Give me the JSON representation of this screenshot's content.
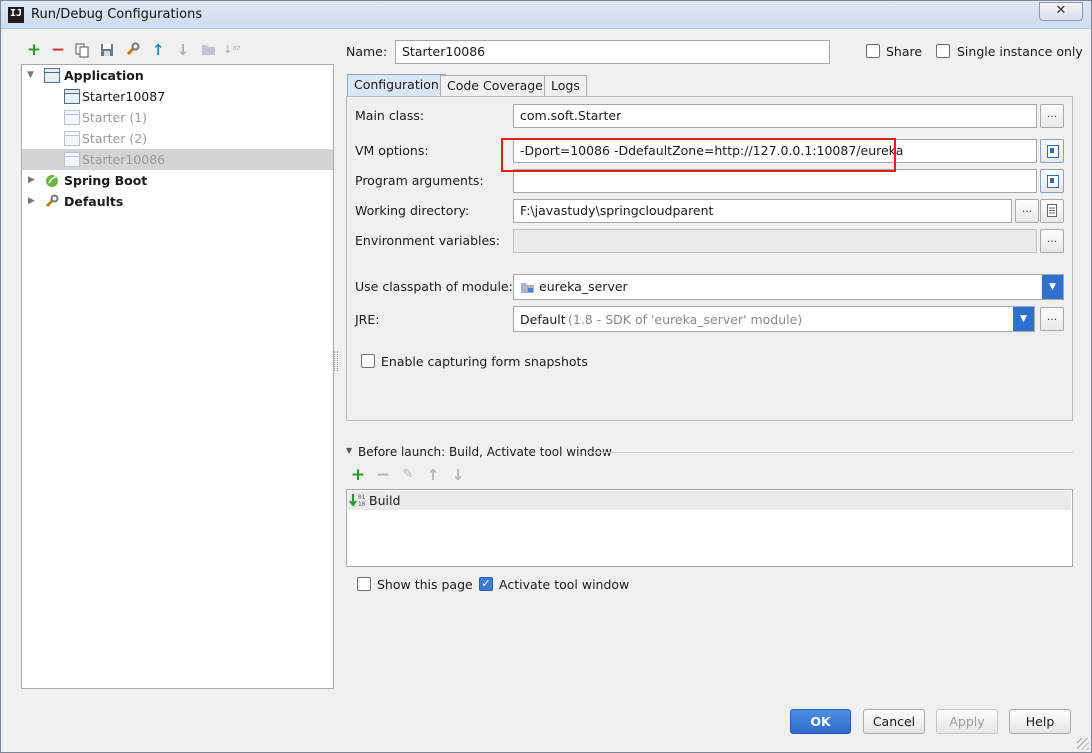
{
  "window": {
    "title": "Run/Debug Configurations",
    "close_glyph": "✕",
    "logo_text": "IJ"
  },
  "toolbar": {
    "icons": [
      "plus-icon",
      "minus-icon",
      "copy-icon",
      "save-icon",
      "wrench-icon",
      "arrow-up-icon",
      "arrow-down-icon",
      "folder-icon",
      "sort-icon"
    ]
  },
  "tree": {
    "items": [
      {
        "label": "Application",
        "icon": "application-icon",
        "expanded": true
      },
      {
        "label": "Starter10087",
        "icon": "config-icon"
      },
      {
        "label": "Starter (1)",
        "icon": "config-icon",
        "dimmed": true
      },
      {
        "label": "Starter (2)",
        "icon": "config-icon",
        "dimmed": true
      },
      {
        "label": "Starter10086",
        "icon": "config-icon",
        "dimmed": true,
        "selected": true
      },
      {
        "label": "Spring Boot",
        "icon": "spring-boot-icon",
        "expanded": false
      },
      {
        "label": "Defaults",
        "icon": "wrench-icon",
        "expanded": false
      }
    ]
  },
  "header": {
    "name_label": "Name:",
    "name_value": "Starter10086",
    "share_label": "Share",
    "share_checked": false,
    "single_instance_label": "Single instance only",
    "single_instance_checked": false
  },
  "tabs": [
    {
      "label": "Configuration",
      "active": true
    },
    {
      "label": "Code Coverage",
      "active": false
    },
    {
      "label": "Logs",
      "active": false
    }
  ],
  "config": {
    "main_class_label": "Main class:",
    "main_class_value": "com.soft.Starter",
    "vm_options_label": "VM options:",
    "vm_options_value": "-Dport=10086 -DdefaultZone=http://127.0.0.1:10087/eureka",
    "program_args_label": "Program arguments:",
    "program_args_value": "",
    "working_dir_label": "Working directory:",
    "working_dir_value": "F:\\javastudy\\springcloudparent",
    "env_vars_label": "Environment variables:",
    "env_vars_value": "",
    "classpath_label": "Use classpath of module:",
    "classpath_value": "eureka_server",
    "jre_label": "JRE:",
    "jre_value": "Default",
    "jre_detail": "(1.8 - SDK of 'eureka_server' module)",
    "snapshots_label": "Enable capturing form snapshots",
    "snapshots_checked": false,
    "ellipsis": "...",
    "dropdown_glyph": "▼"
  },
  "before_launch": {
    "title": "Before launch: Build, Activate tool window",
    "icons": [
      "plus-icon",
      "minus-icon",
      "pencil-icon",
      "arrow-up-icon",
      "arrow-down-icon"
    ],
    "items": [
      {
        "label": "Build",
        "icon": "build-icon"
      }
    ],
    "show_page_label": "Show this page",
    "show_page_checked": false,
    "activate_label": "Activate tool window",
    "activate_checked": true
  },
  "buttons": {
    "ok": "OK",
    "cancel": "Cancel",
    "apply": "Apply",
    "help": "Help"
  },
  "colors": {
    "accent": "#2e6fd0",
    "highlight_box": "#e22020",
    "add": "#2a9a2a",
    "remove": "#d03030"
  }
}
